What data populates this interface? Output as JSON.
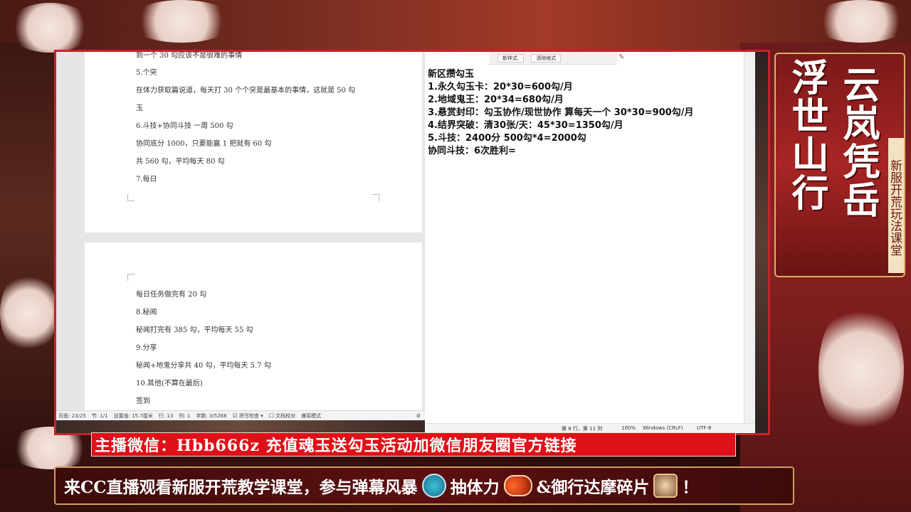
{
  "doc": {
    "page1_lines": [
      "到一个 30 勾应该不是很难的事情",
      "5.个突",
      "在体力获取篇说道，每天打 30 个个突是最基本的事情，这就是 50 勾",
      "玉",
      "6.斗技+协同斗技 一周 500 勾",
      "协同底分 1000，只要能赢 1 把就有 60 勾",
      "共 560 勾，平均每天 80 勾",
      "7.每日"
    ],
    "page2_lines": [
      "每日任务做完有 20 勾",
      "8.秘闻",
      "秘闻打完有 385 勾，平均每天 55 勾",
      "9.分享",
      "秘闻+地鬼分享共 40 勾，平均每天 5.7 勾",
      "10.其他(不算在最后)",
      "签到"
    ],
    "status": {
      "page": "页面: 23/25",
      "section": "节: 1/1",
      "setting": "设置值: 15.7厘米",
      "line": "行: 13",
      "col": "列: 1",
      "wordcount": "字数: 3/5268",
      "spellcheck": "拼写检查",
      "proof": "文档校对",
      "compat": "兼容模式"
    }
  },
  "notepad": {
    "ribbon": [
      "新样式.",
      "清除格式"
    ],
    "lines": [
      "新区攒勾玉",
      "1.永久勾玉卡：20*30=600勾/月",
      "2.地域鬼王：20*34=680勾/月",
      "3.悬赏封印：勾玉协作/现世协作 算每天一个 30*30=900勾/月",
      "4.结界突破：清30张/天：45*30=1350勾/月",
      "5.斗技：2400分 500勾*4=2000勾",
      "协同斗技：6次胜利="
    ],
    "status": {
      "position": "第 8 行，第 11 列",
      "zoom": "100%",
      "eol": "Windows (CRLF)",
      "encoding": "UTF-8"
    }
  },
  "banners": {
    "wechat": "主播微信：Hbb666z 充值魂玉送勾玉活动加微信朋友圈官方链接",
    "bottom_part1": "来CC直播观看新服开荒教学课堂，参与弹幕风暴",
    "bottom_part2": "抽体力",
    "bottom_part3": "&御行达摩碎片",
    "bottom_part4": "！"
  },
  "logo": {
    "col1": "浮世山行",
    "col2": "云岚凭岳",
    "subtitle": "新服开荒玩法课堂"
  }
}
